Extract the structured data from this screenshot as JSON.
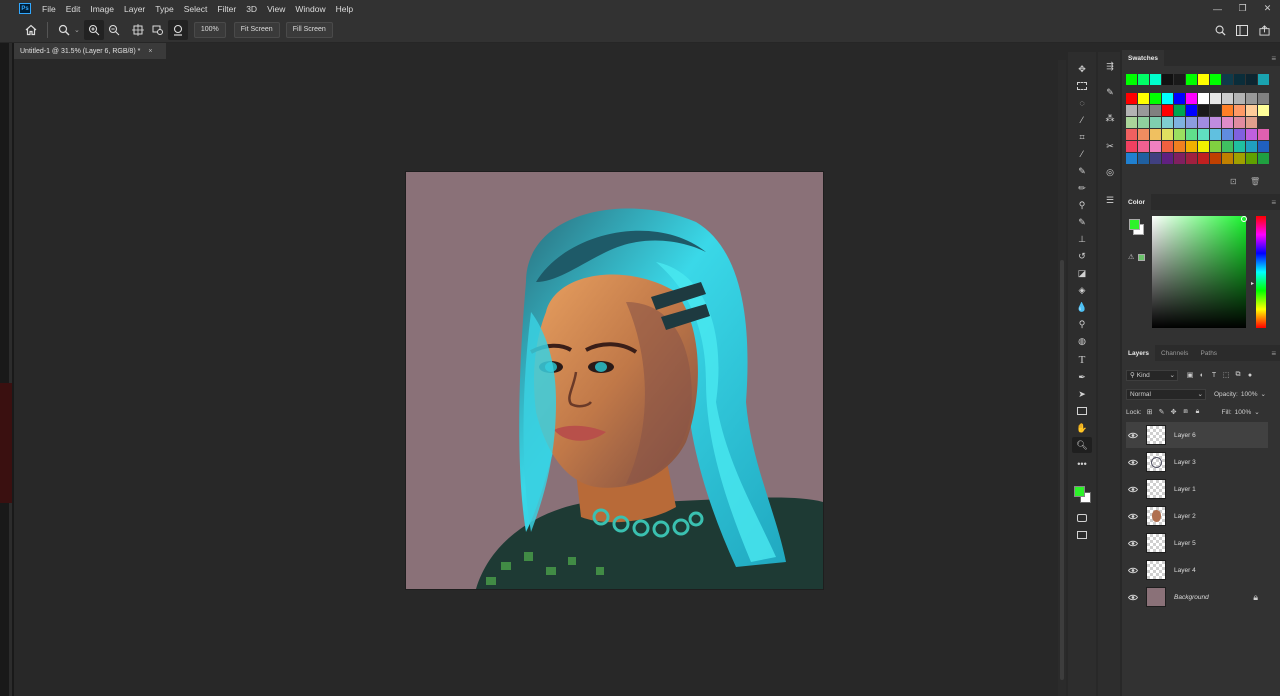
{
  "app": {
    "logo_text": "Ps",
    "menu": [
      "File",
      "Edit",
      "Image",
      "Layer",
      "Type",
      "Select",
      "Filter",
      "3D",
      "View",
      "Window",
      "Help"
    ]
  },
  "options_bar": {
    "zoom_value": "100%",
    "fit_screen_label": "Fit Screen",
    "fill_screen_label": "Fill Screen"
  },
  "document": {
    "tab_title": "Untitled-1 @ 31.5% (Layer 6, RGB/8) *",
    "close_glyph": "×",
    "canvas_bg_color": "#8a7178"
  },
  "tools": [
    {
      "name": "move-tool-icon"
    },
    {
      "name": "marquee-tool-icon"
    },
    {
      "name": "lasso-tool-icon"
    },
    {
      "name": "magic-wand-tool-icon"
    },
    {
      "name": "crop-tool-icon"
    },
    {
      "name": "eyedropper-tool-icon"
    },
    {
      "name": "brush-tool-icon"
    },
    {
      "name": "pencil-tool-icon"
    },
    {
      "name": "clone-stamp-tool-icon"
    },
    {
      "name": "mixer-brush-tool-icon"
    },
    {
      "name": "stamp-tool-icon"
    },
    {
      "name": "history-brush-tool-icon"
    },
    {
      "name": "eraser-tool-icon"
    },
    {
      "name": "paint-bucket-tool-icon"
    },
    {
      "name": "blur-tool-icon"
    },
    {
      "name": "dodge-tool-icon"
    },
    {
      "name": "sponge-tool-icon"
    },
    {
      "name": "type-tool-icon"
    },
    {
      "name": "pen-tool-icon"
    },
    {
      "name": "path-selection-tool-icon"
    },
    {
      "name": "rectangle-tool-icon"
    },
    {
      "name": "hand-tool-icon"
    },
    {
      "name": "zoom-tool-icon"
    },
    {
      "name": "more-tools-icon"
    }
  ],
  "colors": {
    "foreground": "#2df22a",
    "background": "#ffffff"
  },
  "swatches_panel": {
    "title": "Swatches",
    "rows": [
      [
        "#00ff00",
        "#00ff66",
        "#00ffcc",
        "#111111",
        "#1a1a1a",
        "#00ff00",
        "#ffff00",
        "#00ff00",
        "#0f3a4a",
        "#0a2d3a",
        "#0d2530",
        "#1aa3b0",
        "#00ffff",
        "#0a3a3a",
        "#1b3b3b",
        "#0e2e2e",
        "#0a2a2a",
        "#1a5a5a",
        "#333333"
      ],
      [
        "#ff0000",
        "#ffff00",
        "#00ff00",
        "#00ffff",
        "#0000ff",
        "#ff00ff",
        "#ffffff",
        "#e6e6e6",
        "#cccccc",
        "#b3b3b3",
        "#999999",
        "#808080"
      ],
      [
        "#b3b3b3",
        "#999999",
        "#808080",
        "#ff0000",
        "#00a651",
        "#0000ff",
        "#1a1a1a",
        "#262626",
        "#ff7f27",
        "#ff9966",
        "#ffcc99",
        "#ffff99"
      ],
      [
        "#aad59a",
        "#8fd19e",
        "#7fcfb0",
        "#7fcdd0",
        "#7fb2e0",
        "#8c9ce0",
        "#a18ce0",
        "#c08ce0",
        "#e08cc8",
        "#e08ca0",
        "#e0a08c"
      ],
      [
        "#f06060",
        "#f08c60",
        "#f0c060",
        "#e0e060",
        "#9ae060",
        "#60e08c",
        "#60e0c0",
        "#60c0e0",
        "#608ce0",
        "#8060e0",
        "#c060e0",
        "#e060b0"
      ],
      [
        "#f04060",
        "#f06090",
        "#f080c0",
        "#f06040",
        "#f08020",
        "#f0b000",
        "#f0f000",
        "#80d040",
        "#40c060",
        "#20c0a0",
        "#20a0c0",
        "#2060c0"
      ],
      [
        "#2080d0",
        "#2060a0",
        "#404080",
        "#602080",
        "#802060",
        "#a02040",
        "#c02020",
        "#c04000",
        "#c08000",
        "#a0a000",
        "#60a000",
        "#20a040"
      ]
    ]
  },
  "color_panel": {
    "title": "Color"
  },
  "layers_panel": {
    "tabs": [
      "Layers",
      "Channels",
      "Paths"
    ],
    "kind_label": "Kind",
    "blend_mode": "Normal",
    "opacity_label": "Opacity:",
    "opacity_value": "100%",
    "lock_label": "Lock:",
    "fill_label": "Fill:",
    "fill_value": "100%",
    "layers": [
      {
        "name": "Layer 6",
        "selected": true,
        "thumb": "checker"
      },
      {
        "name": "Layer 3",
        "selected": false,
        "thumb": "sketch"
      },
      {
        "name": "Layer 1",
        "selected": false,
        "thumb": "checker"
      },
      {
        "name": "Layer 2",
        "selected": false,
        "thumb": "face"
      },
      {
        "name": "Layer 5",
        "selected": false,
        "thumb": "checker"
      },
      {
        "name": "Layer 4",
        "selected": false,
        "thumb": "checker"
      },
      {
        "name": "Background",
        "selected": false,
        "thumb": "solid",
        "locked": true
      }
    ]
  }
}
